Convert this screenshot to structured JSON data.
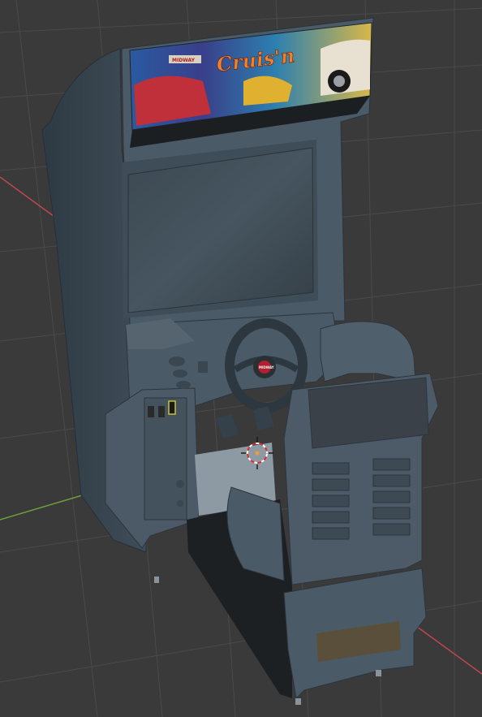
{
  "viewport": {
    "background": "#3a3a3a",
    "grid_color": "#4a4a4a",
    "x_axis_color": "#c0464f",
    "y_axis_color": "#6e9e3c",
    "cursor_icon": "3d-cursor-icon"
  },
  "model": {
    "body_color": "#4a5a66",
    "screen_color": "#3a4750",
    "marquee": {
      "text": "Cruis'n",
      "badge": "MIDWAY"
    },
    "wheel_badge": "MIDWAY"
  }
}
